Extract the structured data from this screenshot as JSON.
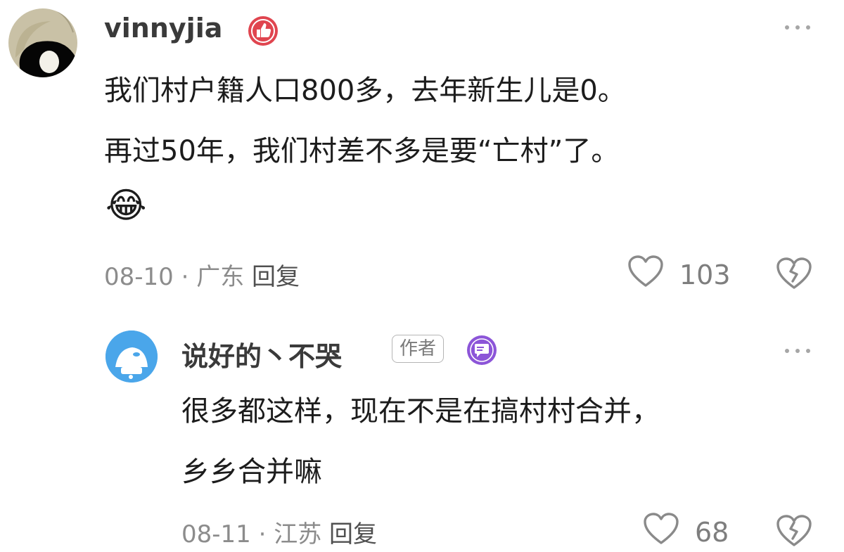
{
  "comments": [
    {
      "username": "vinnyjia",
      "badge_icon": "thumbs-up-badge-icon",
      "lines": [
        "我们村户籍人口800多，去年新生儿是0。",
        "再过50年，我们村差不多是要“亡村”了。"
      ],
      "emoji": "😂",
      "date": "08-10",
      "separator": "·",
      "location": "广东",
      "reply_label": "回复",
      "likes": "103"
    },
    {
      "username": "说好的丶不哭",
      "author_tag": "作者",
      "badge_icon": "message-badge-icon",
      "lines": [
        "很多都这样，现在不是在搞村村合并，",
        "乡乡合并嘛"
      ],
      "date": "08-11",
      "separator": "·",
      "location": "江苏",
      "reply_label": "回复",
      "likes": "68"
    }
  ],
  "colors": {
    "badge_red": "#e0454f",
    "badge_purple": "#8c55d8",
    "avatar_blue": "#4aa6ea"
  }
}
